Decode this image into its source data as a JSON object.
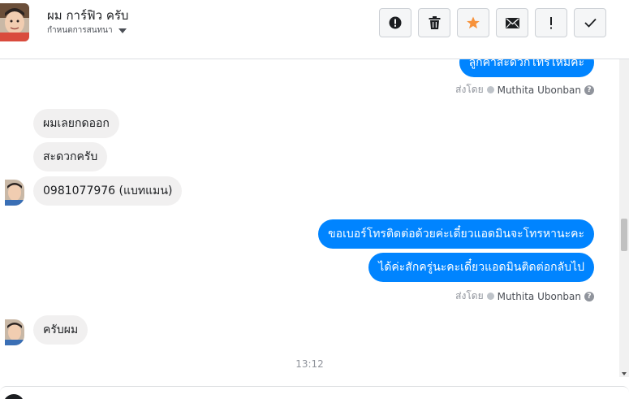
{
  "header": {
    "title": "ผม การ์ฟิว ครับ",
    "subtitle": "กำหนดการสนทนา",
    "actions": [
      {
        "name": "report-button",
        "icon": "alert-circle-icon"
      },
      {
        "name": "delete-button",
        "icon": "trash-icon"
      },
      {
        "name": "star-button",
        "icon": "star-icon",
        "color": "#f7923b"
      },
      {
        "name": "mark-unread-button",
        "icon": "envelope-icon"
      },
      {
        "name": "important-button",
        "icon": "exclamation-icon"
      },
      {
        "name": "done-button",
        "icon": "checkmark-icon"
      }
    ]
  },
  "messages": {
    "top_out": "ลูกค้าสะดวกโทรไหมคะ",
    "sent_by_1": {
      "prefix": "ส่งโดย",
      "name": "Muthita Ubonban"
    },
    "in_1": "ผมเลยกดออก",
    "in_2": "สะดวกครับ",
    "in_3": "0981077976 (แบทแมน)",
    "out_1": "ขอเบอร์โทรติดต่อด้วยค่ะเดี๋ยวแอดมินจะโทรหานะคะ",
    "out_2": "ได้ค่ะสักครู่นะคะเดี๋ยวแอดมินติดต่อกลับไป",
    "sent_by_2": {
      "prefix": "ส่งโดย",
      "name": "Muthita Ubonban"
    },
    "in_4": "ครับผม",
    "time": "13:12"
  },
  "colors": {
    "outgoing_bubble": "#0084ff",
    "incoming_bubble": "#f1f0f0",
    "star": "#f7923b"
  }
}
